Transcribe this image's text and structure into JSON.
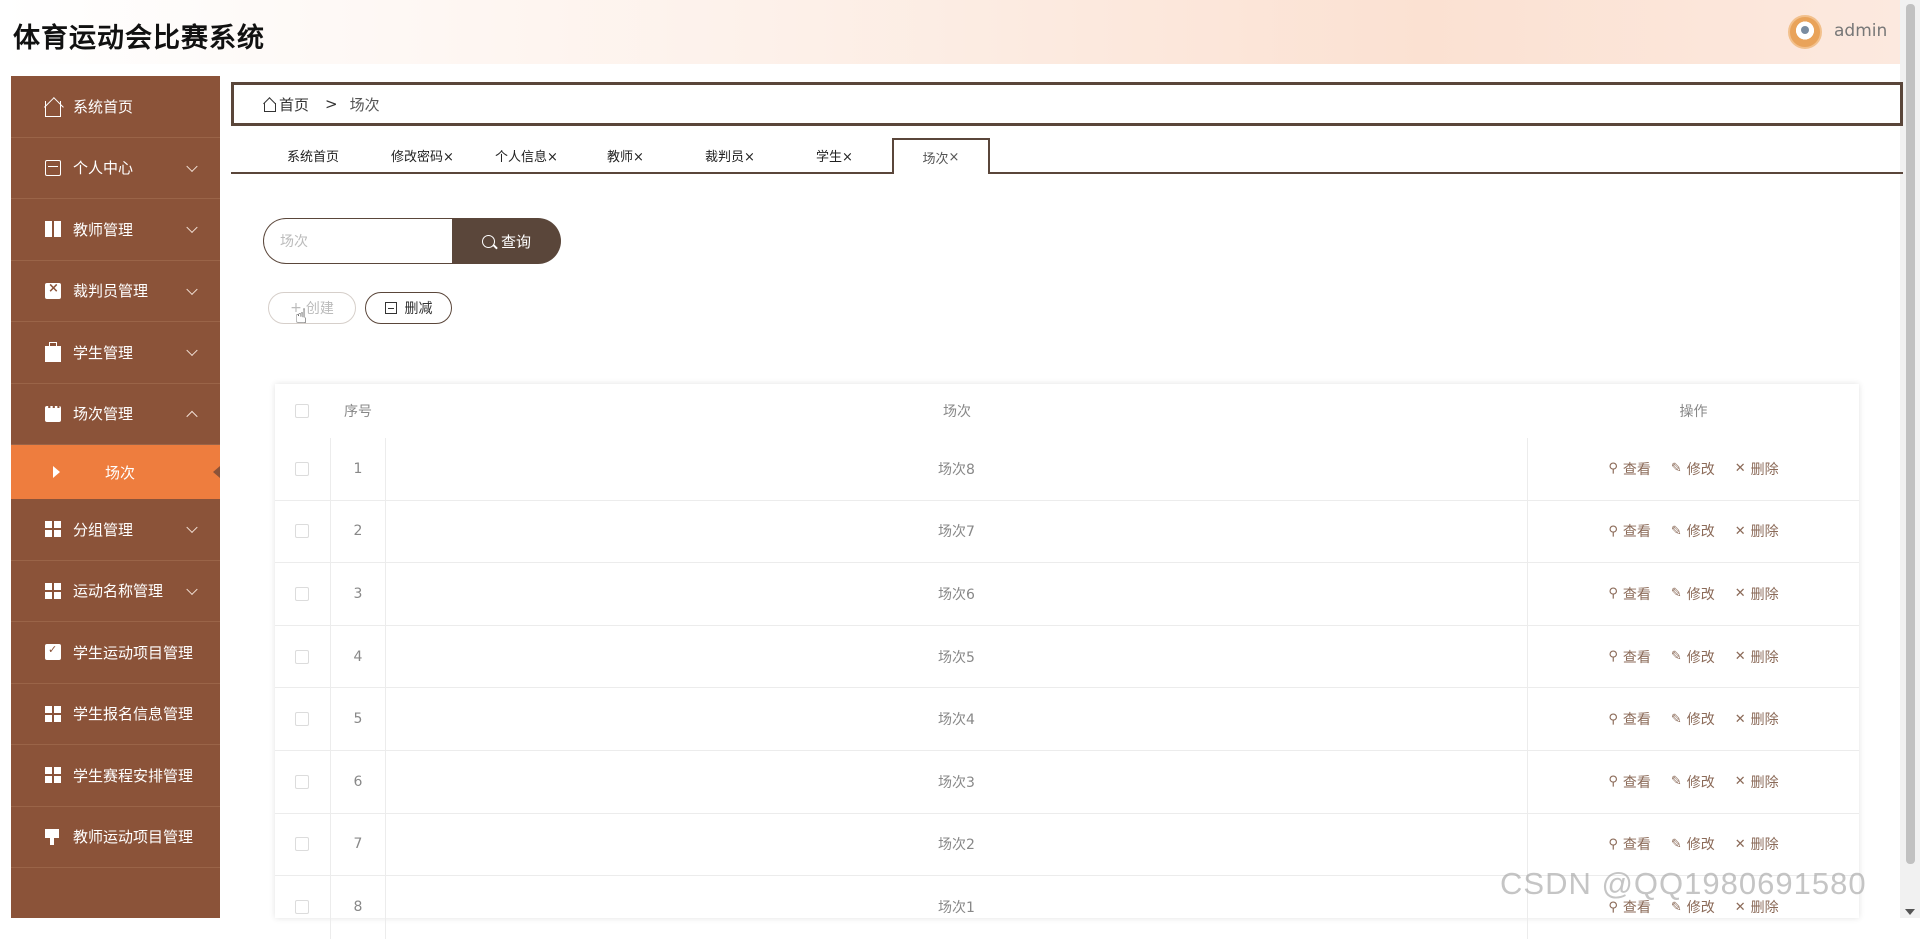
{
  "header": {
    "title": "体育运动会比赛系统",
    "username": "admin"
  },
  "sidebar": {
    "items": [
      {
        "label": "系统首页",
        "icon": "home-icon",
        "chevron": ""
      },
      {
        "label": "个人中心",
        "icon": "card-icon",
        "chevron": "down"
      },
      {
        "label": "教师管理",
        "icon": "book-icon",
        "chevron": "down"
      },
      {
        "label": "裁判员管理",
        "icon": "clipboard-x-icon",
        "chevron": "down"
      },
      {
        "label": "学生管理",
        "icon": "briefcase-icon",
        "chevron": "down"
      },
      {
        "label": "场次管理",
        "icon": "chat-icon",
        "chevron": "up"
      }
    ],
    "active_sub": "场次",
    "items_after": [
      {
        "label": "分组管理",
        "icon": "grid-icon",
        "chevron": "down"
      },
      {
        "label": "运动名称管理",
        "icon": "grid-icon",
        "chevron": "down"
      },
      {
        "label": "学生运动项目管理",
        "icon": "checklist-icon",
        "chevron": ""
      },
      {
        "label": "学生报名信息管理",
        "icon": "grid-icon",
        "chevron": ""
      },
      {
        "label": "学生赛程安排管理",
        "icon": "grid-icon",
        "chevron": ""
      },
      {
        "label": "教师运动项目管理",
        "icon": "stamp-icon",
        "chevron": ""
      }
    ]
  },
  "breadcrumb": {
    "home": "首页",
    "separator": ">",
    "current": "场次"
  },
  "tabs": [
    {
      "label": "系统首页",
      "closable": false
    },
    {
      "label": "修改密码",
      "closable": true
    },
    {
      "label": "个人信息",
      "closable": true
    },
    {
      "label": "教师",
      "closable": true
    },
    {
      "label": "裁判员",
      "closable": true
    },
    {
      "label": "学生",
      "closable": true
    },
    {
      "label": "场次",
      "closable": true,
      "active": true
    }
  ],
  "search": {
    "placeholder": "场次",
    "button_label": "查询"
  },
  "actions": {
    "create_label": "创建",
    "delete_label": "删减"
  },
  "table": {
    "headers": {
      "index": "序号",
      "name": "场次",
      "ops": "操作"
    },
    "rows": [
      {
        "index": "1",
        "name": "场次8"
      },
      {
        "index": "2",
        "name": "场次7"
      },
      {
        "index": "3",
        "name": "场次6"
      },
      {
        "index": "4",
        "name": "场次5"
      },
      {
        "index": "5",
        "name": "场次4"
      },
      {
        "index": "6",
        "name": "场次3"
      },
      {
        "index": "7",
        "name": "场次2"
      },
      {
        "index": "8",
        "name": "场次1"
      }
    ],
    "op_labels": {
      "view": "查看",
      "edit": "修改",
      "delete": "删除"
    }
  },
  "watermark": "CSDN @QQ1980691580",
  "colors": {
    "sidebar": "#8b5339",
    "active": "#ee7d3e",
    "accent": "#5a463a"
  }
}
